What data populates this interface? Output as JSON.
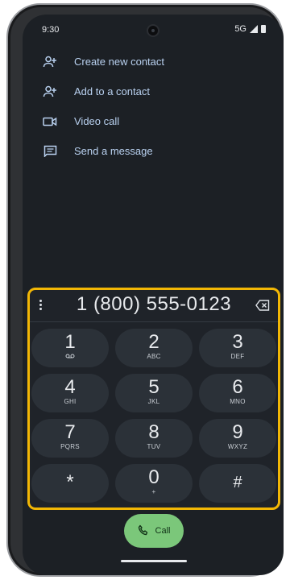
{
  "status": {
    "time": "9:30",
    "network": "5G"
  },
  "menu": [
    {
      "label": "Create new contact",
      "icon": "person-add-icon"
    },
    {
      "label": "Add to a contact",
      "icon": "person-add-icon"
    },
    {
      "label": "Video call",
      "icon": "video-call-icon"
    },
    {
      "label": "Send a message",
      "icon": "message-icon"
    }
  ],
  "dialpad": {
    "number": "1 (800) 555-0123",
    "keys": [
      {
        "digit": "1",
        "letters": "voicemail"
      },
      {
        "digit": "2",
        "letters": "ABC"
      },
      {
        "digit": "3",
        "letters": "DEF"
      },
      {
        "digit": "4",
        "letters": "GHI"
      },
      {
        "digit": "5",
        "letters": "JKL"
      },
      {
        "digit": "6",
        "letters": "MNO"
      },
      {
        "digit": "7",
        "letters": "PQRS"
      },
      {
        "digit": "8",
        "letters": "TUV"
      },
      {
        "digit": "9",
        "letters": "WXYZ"
      },
      {
        "digit": "*",
        "letters": ""
      },
      {
        "digit": "0",
        "letters": "+"
      },
      {
        "digit": "#",
        "letters": ""
      }
    ]
  },
  "call": {
    "label": "Call"
  },
  "colors": {
    "highlight": "#f2b705",
    "call_button": "#7bc77a",
    "background": "#1c2025"
  }
}
